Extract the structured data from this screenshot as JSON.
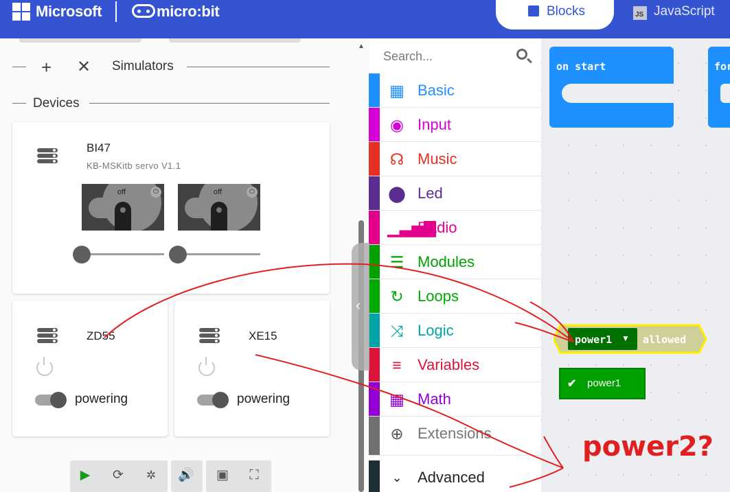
{
  "header": {
    "brand_microsoft": "Microsoft",
    "brand_microbit": "micro:bit",
    "tab_blocks": "Blocks",
    "tab_javascript": "JavaScript",
    "tab_javascript_badge": "JS",
    "color": "#3454d1"
  },
  "simulators": {
    "label": "Simulators",
    "devices_label": "Devices",
    "devices": [
      {
        "name": "BI47",
        "subtitle": "KB-MSKitb servo V1.1",
        "servo_state": "off"
      },
      {
        "name": "ZD55",
        "toggle_label": "powering"
      },
      {
        "name": "XE15",
        "toggle_label": "powering"
      }
    ]
  },
  "toolbox": {
    "search_placeholder": "Search...",
    "categories": [
      {
        "label": "Basic",
        "color": "#1e90ff",
        "icon": "grid-icon"
      },
      {
        "label": "Input",
        "color": "#d400d4",
        "icon": "target-icon"
      },
      {
        "label": "Music",
        "color": "#e63022",
        "icon": "headphones-icon"
      },
      {
        "label": "Led",
        "color": "#5c2d91",
        "icon": "toggle-icon"
      },
      {
        "label": "Radio",
        "color": "#e3008c",
        "icon": "signal-icon"
      },
      {
        "label": "Modules",
        "color": "#00a000",
        "icon": "modules-icon"
      },
      {
        "label": "Loops",
        "color": "#00aa00",
        "icon": "loop-icon"
      },
      {
        "label": "Logic",
        "color": "#00a4a6",
        "icon": "shuffle-icon"
      },
      {
        "label": "Variables",
        "color": "#dc143c",
        "icon": "list-icon"
      },
      {
        "label": "Math",
        "color": "#9400d3",
        "icon": "calculator-icon"
      },
      {
        "label": "Extensions",
        "color": "#717171",
        "icon": "plus-circle-icon"
      },
      {
        "label": "Advanced",
        "color": "#1f2f35",
        "icon": "chevron-down-icon"
      }
    ]
  },
  "workspace": {
    "on_start": "on start",
    "forever_partial": "for",
    "block_power1": "power1",
    "block_allowed": "allowed",
    "block_power1_check": "power1",
    "annotation": "power2?"
  }
}
